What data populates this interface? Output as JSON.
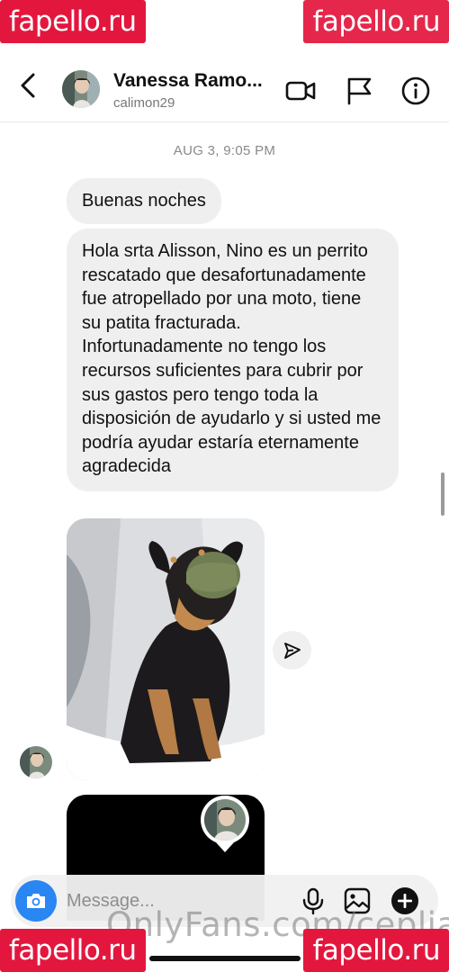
{
  "watermarks": {
    "top_left": "fapello.ru",
    "top_right": "fapello.ru",
    "bottom_left": "fapello.ru",
    "bottom_right": "fapello.ru",
    "onlyfans": "OnlyFans.com/ceplia"
  },
  "status_bar": {
    "text": "• • •"
  },
  "header": {
    "name": "Vanessa Ramo...",
    "username": "calimon29",
    "icons": [
      "back-icon",
      "video-call-icon",
      "flag-icon",
      "info-icon"
    ]
  },
  "conversation": {
    "timestamp": "AUG 3, 9:05 PM",
    "messages": [
      {
        "type": "text",
        "text": "Buenas noches"
      },
      {
        "type": "text",
        "text": "Hola srta Alisson, Nino es un perrito rescatado que desafortunadamente fue atropellado por una moto, tiene su patita fracturada. Infortunadamente no tengo los recursos suficientes para  cubrir por sus gastos pero tengo toda la disposición de ayudarlo y si usted me podría ayudar estaría eternamente agradecida"
      },
      {
        "type": "photo",
        "subject": "dog-with-green-muzzle"
      },
      {
        "type": "shared-reel"
      }
    ]
  },
  "composer": {
    "placeholder": "Message...",
    "icons": [
      "camera-icon",
      "microphone-icon",
      "gallery-icon",
      "add-icon"
    ]
  },
  "colors": {
    "accent_blue": "#2a86f3",
    "bubble_gray": "#efefef",
    "watermark_red": "#e3173e"
  }
}
